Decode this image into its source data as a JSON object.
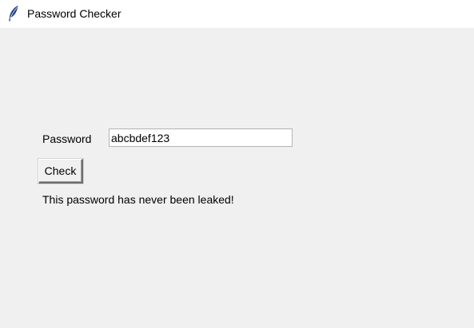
{
  "window": {
    "title": "Password Checker",
    "icon": "feather-icon"
  },
  "form": {
    "password_label": "Password",
    "password_value": "abcbdef123",
    "check_button_label": "Check",
    "result_message": "This password has never been leaked!"
  }
}
